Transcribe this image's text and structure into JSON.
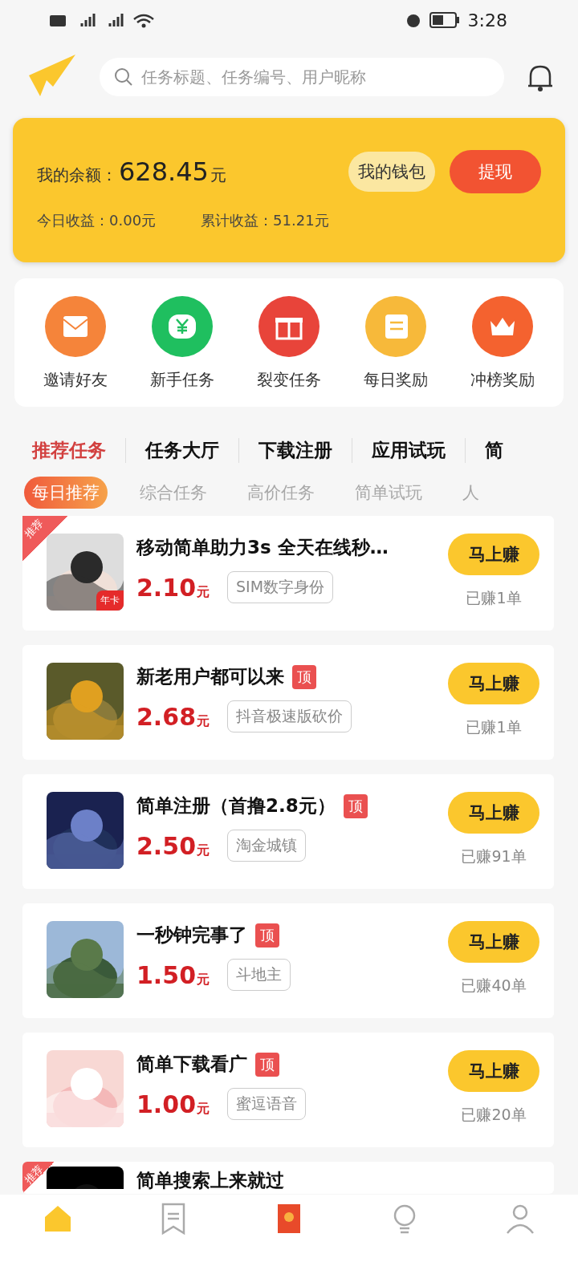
{
  "status_bar": {
    "time": "3:28"
  },
  "search": {
    "placeholder": "任务标题、任务编号、用户昵称"
  },
  "balance": {
    "label": "我的余额：",
    "amount": "628.45",
    "unit": "元",
    "wallet_button": "我的钱包",
    "withdraw_button": "提现",
    "today": "今日收益：0.00元",
    "total": "累计收益：51.21元"
  },
  "quick_actions": [
    {
      "label": "邀请好友",
      "kind": "mail",
      "color": "#f5843a"
    },
    {
      "label": "新手任务",
      "kind": "yen",
      "color": "#1fbf5f"
    },
    {
      "label": "裂变任务",
      "kind": "gift",
      "color": "#e8443a"
    },
    {
      "label": "每日奖励",
      "kind": "doc",
      "color": "#f7b93a"
    },
    {
      "label": "冲榜奖励",
      "kind": "crown",
      "color": "#f4622f"
    }
  ],
  "tabs": [
    {
      "label": "推荐任务",
      "selected": true
    },
    {
      "label": "任务大厅",
      "selected": false
    },
    {
      "label": "下载注册",
      "selected": false
    },
    {
      "label": "应用试玩",
      "selected": false
    },
    {
      "label": "简",
      "selected": false
    }
  ],
  "sub_tabs": [
    {
      "label": "每日推荐",
      "selected": true
    },
    {
      "label": "综合任务",
      "selected": false
    },
    {
      "label": "高价任务",
      "selected": false
    },
    {
      "label": "简单试玩",
      "selected": false
    },
    {
      "label": "人",
      "selected": false
    }
  ],
  "tasks": [
    {
      "title": "移动简单助力3s 全天在线秒…",
      "pinned": false,
      "recommended": true,
      "ribbon": "推荐",
      "badge": "年卡",
      "price": "2.10",
      "unit": "元",
      "tag": "SIM数字身份",
      "button": "马上赚",
      "earned": "已赚1单"
    },
    {
      "title": "新老用户都可以来",
      "pinned": true,
      "pin_label": "顶",
      "recommended": false,
      "price": "2.68",
      "unit": "元",
      "tag": "抖音极速版砍价",
      "button": "马上赚",
      "earned": "已赚1单"
    },
    {
      "title": "简单注册（首撸2.8元）",
      "pinned": true,
      "pin_label": "顶",
      "recommended": false,
      "price": "2.50",
      "unit": "元",
      "tag": "淘金城镇",
      "button": "马上赚",
      "earned": "已赚91单"
    },
    {
      "title": "一秒钟完事了",
      "pinned": true,
      "pin_label": "顶",
      "recommended": false,
      "price": "1.50",
      "unit": "元",
      "tag": "斗地主",
      "button": "马上赚",
      "earned": "已赚40单"
    },
    {
      "title": "简单下载看广",
      "pinned": true,
      "pin_label": "顶",
      "recommended": false,
      "price": "1.00",
      "unit": "元",
      "tag": "蜜逗语音",
      "button": "马上赚",
      "earned": "已赚20单"
    },
    {
      "title": "简单搜索上来就过",
      "pinned": false,
      "recommended": true,
      "ribbon": "推荐"
    }
  ],
  "bottom_nav": [
    {
      "kind": "home",
      "selected": true
    },
    {
      "kind": "bookmark",
      "selected": false
    },
    {
      "kind": "envelope",
      "selected": false
    },
    {
      "kind": "bulb",
      "selected": false
    },
    {
      "kind": "person",
      "selected": false
    }
  ]
}
